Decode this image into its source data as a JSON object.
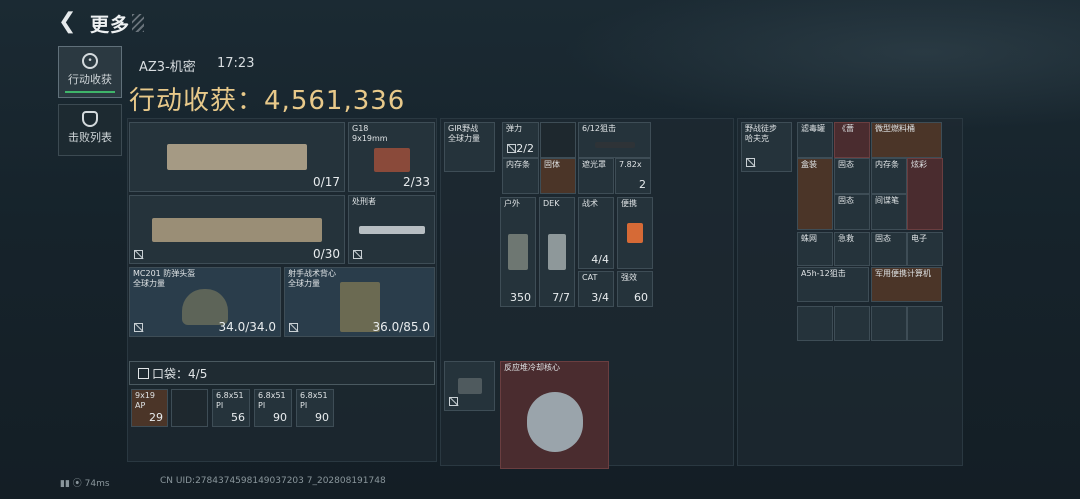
{
  "header": {
    "title": "更多"
  },
  "sidebar": [
    {
      "label": "行动收获",
      "active": true
    },
    {
      "label": "击败列表",
      "active": false
    }
  ],
  "info": {
    "map": "AZ3-机密",
    "time": "17:23",
    "yield_label": "行动收获：",
    "yield_value": "4,561,336"
  },
  "weapons": [
    {
      "name": "",
      "qty": "0/17"
    },
    {
      "name": "G18\n9x19mm",
      "qty": "2/33"
    },
    {
      "name": "",
      "qty": "0/30"
    },
    {
      "name": "处刑者",
      "qty": ""
    },
    {
      "name": "MC201 防弹头盔\n全球力量",
      "qty": "34.0/34.0"
    },
    {
      "name": "射手战术背心\n全球力量",
      "qty": "36.0/85.0"
    }
  ],
  "pocket": {
    "label": "口袋：",
    "count": "4/5",
    "items": [
      {
        "name": "9x19\nAP",
        "qty": "29"
      },
      {
        "name": "",
        "qty": ""
      },
      {
        "name": "6.8x51\nPI",
        "qty": "56"
      },
      {
        "name": "6.8x51\nPI",
        "qty": "90"
      },
      {
        "name": "6.8x51\nPI",
        "qty": "90"
      }
    ]
  },
  "rig": [
    {
      "name": "GIR野战\n全球力量",
      "qty": ""
    },
    {
      "name": "弹力",
      "qty": "2/2"
    },
    {
      "name": "",
      "qty": ""
    },
    {
      "name": "6/12狙击",
      "qty": ""
    },
    {
      "name": "内存条",
      "qty": ""
    },
    {
      "name": "固体",
      "qty": ""
    },
    {
      "name": "遮光罩",
      "qty": ""
    },
    {
      "name": "7.82x",
      "qty": "2"
    },
    {
      "name": "户外",
      "qty": "350"
    },
    {
      "name": "DEK",
      "qty": "7/7"
    },
    {
      "name": "战术",
      "qty": "4/4"
    },
    {
      "name": "便携",
      "qty": ""
    },
    {
      "name": "CAT",
      "qty": "3/4"
    },
    {
      "name": "强效",
      "qty": "60"
    }
  ],
  "backpack_item": {
    "name": "",
    "qty": ""
  },
  "core": {
    "name": "反应堆冷却核心"
  },
  "bag": [
    {
      "name": "野战徒步\n哈夫克",
      "qty": ""
    },
    {
      "name": "滤毒罐",
      "qty": ""
    },
    {
      "name": "《蔷",
      "qty": ""
    },
    {
      "name": "微型燃料桶",
      "qty": ""
    },
    {
      "name": "盒装",
      "qty": ""
    },
    {
      "name": "固态",
      "qty": ""
    },
    {
      "name": "内存条",
      "qty": ""
    },
    {
      "name": "炫彩",
      "qty": ""
    },
    {
      "name": "固态",
      "qty": ""
    },
    {
      "name": "间谍笔",
      "qty": ""
    },
    {
      "name": "蛛网",
      "qty": ""
    },
    {
      "name": "急救",
      "qty": ""
    },
    {
      "name": "固态",
      "qty": ""
    },
    {
      "name": "电子",
      "qty": ""
    },
    {
      "name": "A5h-12狙击",
      "qty": ""
    },
    {
      "name": "军用便携计算机",
      "qty": ""
    },
    {
      "name": "",
      "qty": ""
    },
    {
      "name": "",
      "qty": ""
    },
    {
      "name": "",
      "qty": ""
    },
    {
      "name": "",
      "qty": ""
    }
  ],
  "status": {
    "ping": "74ms",
    "uid": "CN UID:2784374598149037203 7_202808191748"
  }
}
